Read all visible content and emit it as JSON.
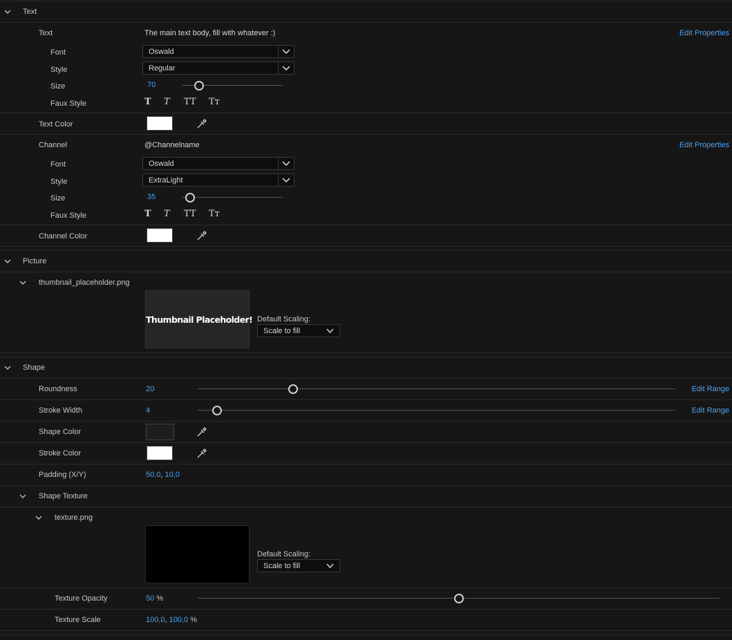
{
  "sections": {
    "text": {
      "title": "Text"
    },
    "picture": {
      "title": "Picture"
    },
    "shape": {
      "title": "Shape"
    }
  },
  "text_layer": {
    "label": "Text",
    "value": "The main text body, fill with whatever :)",
    "edit_link": "Edit Properties",
    "font_label": "Font",
    "font_value": "Oswald",
    "style_label": "Style",
    "style_value": "Regular",
    "size_label": "Size",
    "size_value": "70",
    "size_fraction": 0.17,
    "faux_label": "Faux Style",
    "color_label": "Text Color",
    "color_hex": "#ffffff"
  },
  "channel_layer": {
    "label": "Channel",
    "value": "@Channelname",
    "edit_link": "Edit Properties",
    "font_label": "Font",
    "font_value": "Oswald",
    "style_label": "Style",
    "style_value": "ExtraLight",
    "size_label": "Size",
    "size_value": "35",
    "size_fraction": 0.08,
    "faux_label": "Faux Style",
    "color_label": "Channel Color",
    "color_hex": "#ffffff"
  },
  "faux_styles": [
    "T",
    "T",
    "TT",
    "Tт"
  ],
  "picture": {
    "file": "thumbnail_placeholder.png",
    "thumb_text": "Thumbnail Placeholder!",
    "scaling_label": "Default Scaling:",
    "scaling_value": "Scale to fill"
  },
  "shape": {
    "roundness_label": "Roundness",
    "roundness_value": "20",
    "roundness_fraction": 0.2,
    "stroke_width_label": "Stroke Width",
    "stroke_width_value": "4",
    "stroke_width_fraction": 0.04,
    "edit_range": "Edit Range",
    "shape_color_label": "Shape Color",
    "shape_color_hex": "#1e1e1e",
    "stroke_color_label": "Stroke Color",
    "stroke_color_hex": "#ffffff",
    "padding_label": "Padding (X/Y)",
    "padding_x": "50,0",
    "padding_y": "10,0",
    "texture_group": "Shape Texture",
    "texture_file": "texture.png",
    "texture_scaling_label": "Default Scaling:",
    "texture_scaling_value": "Scale to fill",
    "opacity_label": "Texture Opacity",
    "opacity_value": "50",
    "opacity_unit": "%",
    "opacity_fraction": 0.5,
    "scale_label": "Texture Scale",
    "scale_x": "100,0",
    "scale_y": "100,0",
    "scale_unit": "%"
  },
  "separator": ", "
}
